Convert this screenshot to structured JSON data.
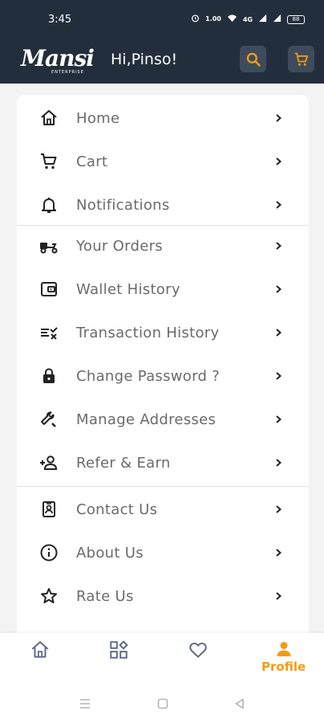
{
  "status": {
    "time": "3:45",
    "icons": [
      "alarm-icon",
      "data-speed-icon",
      "wifi-icon",
      "volte-icon",
      "signal-icon",
      "signal-icon-2"
    ],
    "speed": "1.00",
    "battery": "88"
  },
  "header": {
    "brand": "Mansi",
    "brand_sub": "ENTERPRISE",
    "greeting": "Hi,Pinso!"
  },
  "menu": {
    "items": [
      {
        "label": "Home",
        "icon": "home-icon"
      },
      {
        "label": "Cart",
        "icon": "cart-icon"
      },
      {
        "label": "Notifications",
        "icon": "bell-icon"
      },
      {
        "label": "Your Orders",
        "icon": "delivery-scooter-icon"
      },
      {
        "label": "Wallet History",
        "icon": "wallet-icon"
      },
      {
        "label": "Transaction History",
        "icon": "transaction-list-icon"
      },
      {
        "label": "Change Password ?",
        "icon": "lock-icon"
      },
      {
        "label": "Manage Addresses",
        "icon": "wrench-icon"
      },
      {
        "label": "Refer & Earn",
        "icon": "add-person-icon"
      },
      {
        "label": "Contact Us",
        "icon": "contact-badge-icon"
      },
      {
        "label": "About Us",
        "icon": "info-icon"
      },
      {
        "label": "Rate Us",
        "icon": "star-icon"
      }
    ]
  },
  "bottom_nav": {
    "items": [
      {
        "name": "home",
        "icon": "home-icon"
      },
      {
        "name": "categories",
        "icon": "categories-icon"
      },
      {
        "name": "wishlist",
        "icon": "heart-icon"
      },
      {
        "name": "profile",
        "icon": "person-icon",
        "label": "Profile"
      }
    ],
    "active": "profile"
  },
  "colors": {
    "header_bg": "#232e3c",
    "button_bg": "#3e4b5c",
    "accent": "#f39c12",
    "label": "#6b6b6b"
  }
}
